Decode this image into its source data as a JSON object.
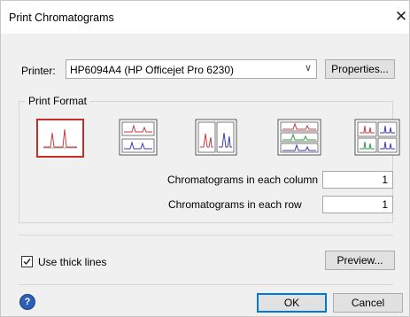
{
  "window": {
    "title": "Print Chromatograms",
    "close_icon": "close-icon"
  },
  "printer": {
    "label": "Printer:",
    "selected": "HP6094A4 (HP Officejet Pro 6230)",
    "properties_label": "Properties..."
  },
  "print_format": {
    "label": "Print Format",
    "options": [
      {
        "name": "single-chromatogram",
        "selected": true
      },
      {
        "name": "two-stacked-rows",
        "selected": false
      },
      {
        "name": "two-side-by-side",
        "selected": false
      },
      {
        "name": "three-stacked-rows",
        "selected": false
      },
      {
        "name": "grid-2x2",
        "selected": false
      }
    ],
    "column_label": "Chromatograms in each column",
    "column_value": "1",
    "row_label": "Chromatograms in each row",
    "row_value": "1"
  },
  "options": {
    "thick_lines_label": "Use thick lines",
    "thick_lines_checked": true,
    "preview_label": "Preview..."
  },
  "footer": {
    "ok_label": "OK",
    "cancel_label": "Cancel",
    "help_icon": "help-icon"
  },
  "colors": {
    "accent": "#0078d7",
    "selected_border": "#cc2b2b",
    "trace_red": "#c83c3c",
    "trace_blue": "#3a3aa8",
    "trace_green": "#2e9a3e"
  }
}
